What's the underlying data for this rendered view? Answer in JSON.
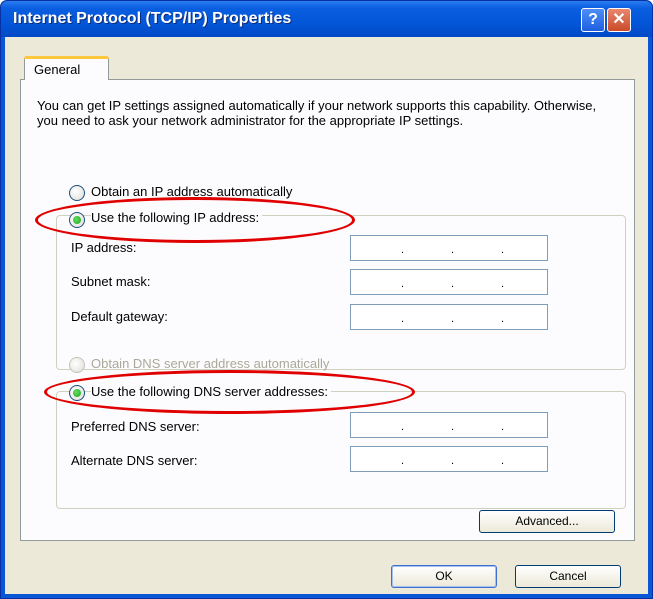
{
  "window": {
    "title": "Internet Protocol (TCP/IP) Properties",
    "help_glyph": "?",
    "close_glyph": "✕"
  },
  "tabs": [
    "General"
  ],
  "intro_text": "You can get IP settings assigned automatically if your network supports this capability. Otherwise, you need to ask your network administrator for the appropriate IP settings.",
  "ip_radios": [
    {
      "label": "Obtain an IP address automatically",
      "checked": false
    },
    {
      "label": "Use the following IP address:",
      "checked": true
    }
  ],
  "ip_fields": [
    {
      "label": "IP address:",
      "value": ". . ."
    },
    {
      "label": "Subnet mask:",
      "value": ". . ."
    },
    {
      "label": "Default gateway:",
      "value": ". . ."
    }
  ],
  "dns_radios": [
    {
      "label": "Obtain DNS server address automatically",
      "checked": false,
      "disabled": true
    },
    {
      "label": "Use the following DNS server addresses:",
      "checked": true
    }
  ],
  "dns_fields": [
    {
      "label": "Preferred DNS server:",
      "value": ". . ."
    },
    {
      "label": "Alternate DNS server:",
      "value": ". . ."
    }
  ],
  "buttons": {
    "advanced": "Advanced...",
    "ok": "OK",
    "cancel": "Cancel"
  },
  "colors": {
    "titlebar": "#0a5ee0",
    "face": "#ece9d8",
    "highlight_ring": "#e00000",
    "radio_dot": "#21a121"
  }
}
